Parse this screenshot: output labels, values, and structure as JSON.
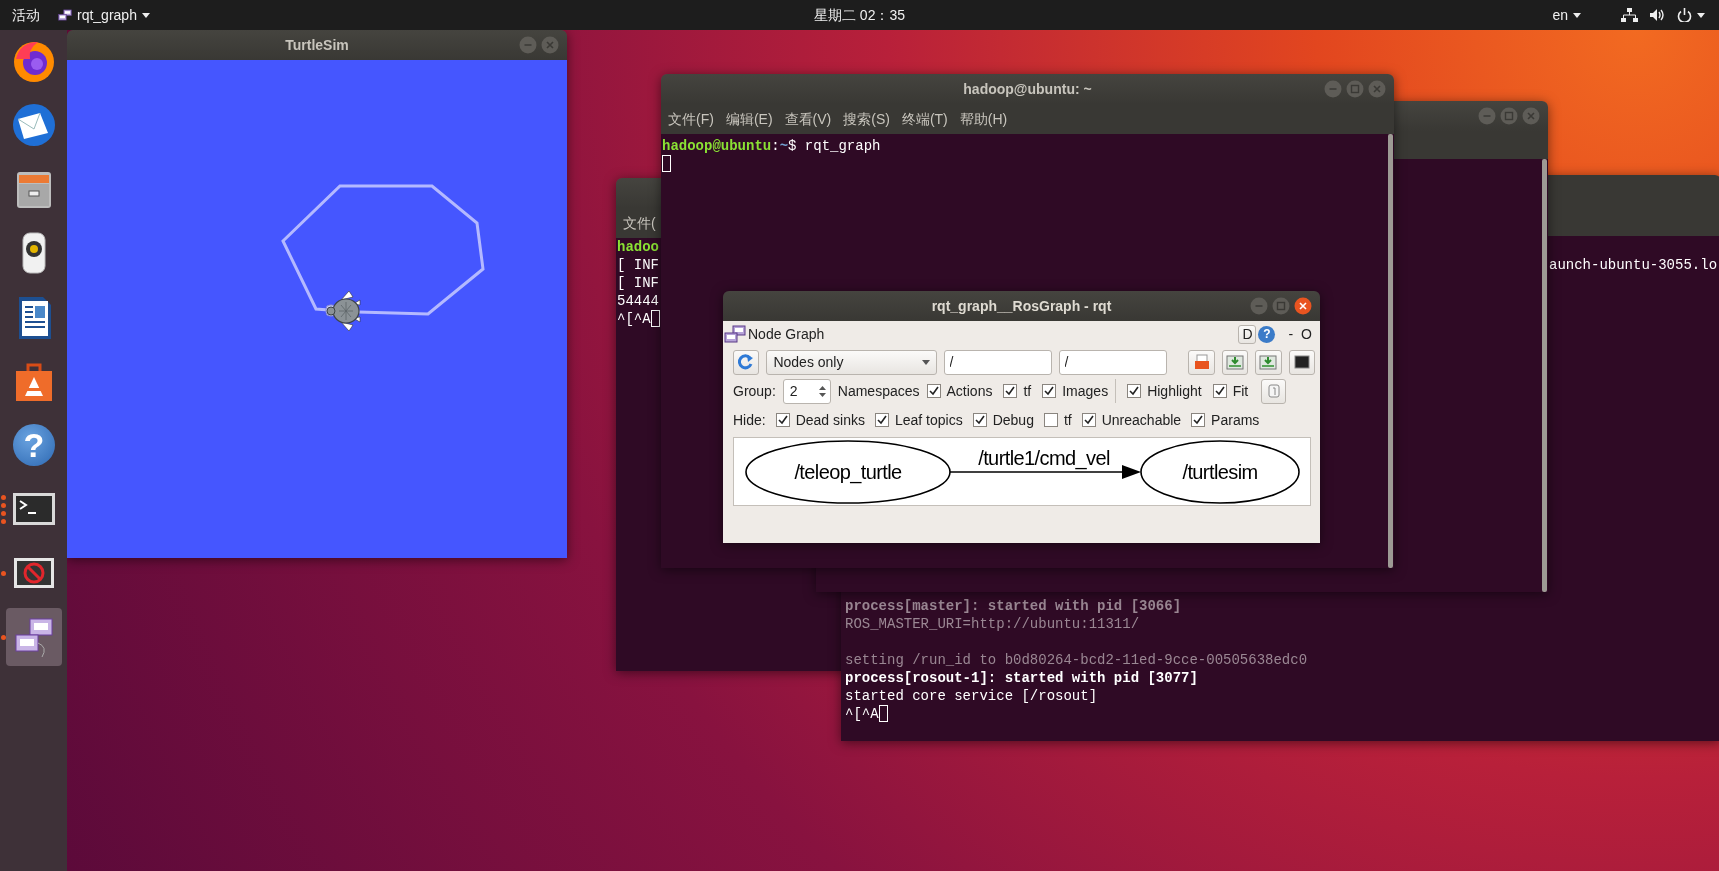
{
  "top_bar": {
    "activities": "活动",
    "app_menu": "rqt_graph",
    "clock": "星期二 02：35",
    "keyboard_layout": "en"
  },
  "dock": [
    {
      "kind": "browser",
      "selected": false,
      "running": false
    },
    {
      "kind": "mail",
      "selected": false,
      "running": false
    },
    {
      "kind": "files",
      "selected": false,
      "running": false
    },
    {
      "kind": "music",
      "selected": false,
      "running": false
    },
    {
      "kind": "writer",
      "selected": false,
      "running": false
    },
    {
      "kind": "store",
      "selected": false,
      "running": false
    },
    {
      "kind": "help",
      "glyph": "?",
      "selected": false,
      "running": false
    },
    {
      "kind": "terminal",
      "selected": false,
      "running": true,
      "multi_window": true
    },
    {
      "kind": "blocked",
      "selected": false,
      "running": true,
      "multi_window": false
    },
    {
      "kind": "network-app",
      "selected": true,
      "running": true,
      "multi_window": false
    }
  ],
  "turtlesim": {
    "title": "TurtleSim"
  },
  "terminal_right": {
    "lines": [
      {
        "spans": [
          {
            "text": "aunch-ubuntu-3055.lo",
            "color": "#ffffff",
            "bold": false
          }
        ]
      },
      {
        "spans": [
          {
            "text": "process[master]: started with pid [3066]",
            "color": "#9a8793",
            "bold": true
          }
        ]
      },
      {
        "spans": [
          {
            "text": "ROS_MASTER_URI=http://ubuntu:11311/",
            "color": "#9a8793",
            "bold": false
          }
        ]
      },
      {
        "spans": [
          {
            "text": "setting /run_id to b0d80264-bcd2-11ed-9cce-00505638edc0",
            "color": "#9a8793",
            "bold": false
          }
        ],
        "blank_before": true
      },
      {
        "spans": [
          {
            "text": "process[rosout-1]: started with pid [3077]",
            "color": "#ffffff",
            "bold": true
          }
        ]
      },
      {
        "spans": [
          {
            "text": "started core service [/rosout]",
            "color": "#ffffff",
            "bold": false
          }
        ]
      },
      {
        "spans": [
          {
            "text": "^[^A",
            "color": "#ffffff",
            "bold": false
          }
        ],
        "cursor": true
      }
    ]
  },
  "terminal_left": {
    "menu": [
      "文件("
    ],
    "lines": [
      {
        "spans": [
          {
            "text": "hadoo",
            "color": "#8ae234",
            "bold": true
          }
        ]
      },
      {
        "spans": [
          {
            "text": "[ INF",
            "color": "#ffffff",
            "bold": false
          }
        ]
      },
      {
        "spans": [
          {
            "text": "[ INF",
            "color": "#ffffff",
            "bold": false
          }
        ]
      },
      {
        "spans": [
          {
            "text": "54444",
            "color": "#ffffff",
            "bold": false
          }
        ]
      },
      {
        "spans": [
          {
            "text": "^[^A",
            "color": "#ffffff",
            "bold": false
          }
        ],
        "cursor": true
      }
    ]
  },
  "terminal_front": {
    "title": "hadoop@ubuntu: ~",
    "menu": [
      "文件(F)",
      "编辑(E)",
      "查看(V)",
      "搜索(S)",
      "终端(T)",
      "帮助(H)"
    ],
    "lines": [
      {
        "spans": [
          {
            "text": "hadoop@ubuntu",
            "color": "#8ae234",
            "bold": true
          },
          {
            "text": ":",
            "color": "#ffffff",
            "bold": false
          },
          {
            "text": "~",
            "color": "#729fcf",
            "bold": true
          },
          {
            "text": "$ rqt_graph",
            "color": "#ffffff",
            "bold": false
          }
        ]
      },
      {
        "cursor": true
      }
    ]
  },
  "rqt": {
    "title": "rqt_graph__RosGraph - rqt",
    "plugin_title": "Node Graph",
    "corner_buttons": [
      {
        "kind": "framed",
        "label": "D"
      },
      {
        "kind": "help",
        "label": "?"
      },
      {
        "kind": "plain",
        "label": "-"
      },
      {
        "kind": "plain",
        "label": "O"
      }
    ],
    "graph_type": "Nodes only",
    "filters": [
      "/",
      "/"
    ],
    "group_label": "Group:",
    "group_value": "2",
    "namespaces_label": "Namespaces",
    "options": [
      {
        "label": "Actions",
        "checked": true
      },
      {
        "label": "tf",
        "checked": true
      },
      {
        "label": "Images",
        "checked": true
      },
      {
        "label": "Highlight",
        "checked": true,
        "separator_before": true
      },
      {
        "label": "Fit",
        "checked": true
      }
    ],
    "hide_label": "Hide:",
    "hide_options": [
      {
        "label": "Dead sinks",
        "checked": true
      },
      {
        "label": "Leaf topics",
        "checked": true
      },
      {
        "label": "Debug",
        "checked": true
      },
      {
        "label": "tf",
        "checked": false
      },
      {
        "label": "Unreachable",
        "checked": true
      },
      {
        "label": "Params",
        "checked": true
      }
    ],
    "graph": {
      "nodes": [
        "/teleop_turtle",
        "/turtlesim"
      ],
      "edges": [
        {
          "label": "/turtle1/cmd_vel"
        }
      ]
    }
  }
}
